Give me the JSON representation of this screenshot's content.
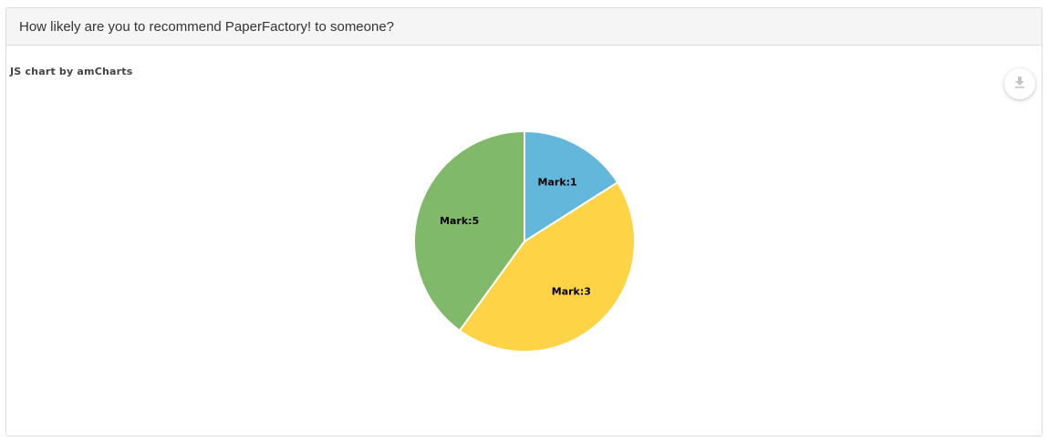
{
  "panel": {
    "title": "How likely are you to recommend PaperFactory! to someone?"
  },
  "chart": {
    "credit": "JS chart by amCharts",
    "export_icon": "download-icon"
  },
  "chart_data": {
    "type": "pie",
    "title": "",
    "categories": [
      "Mark:1",
      "Mark:3",
      "Mark:5"
    ],
    "values": [
      16,
      44,
      40
    ],
    "colors": [
      "#63b7da",
      "#fed346",
      "#81b96b"
    ],
    "start_angle_deg": 0,
    "direction": "clockwise"
  }
}
